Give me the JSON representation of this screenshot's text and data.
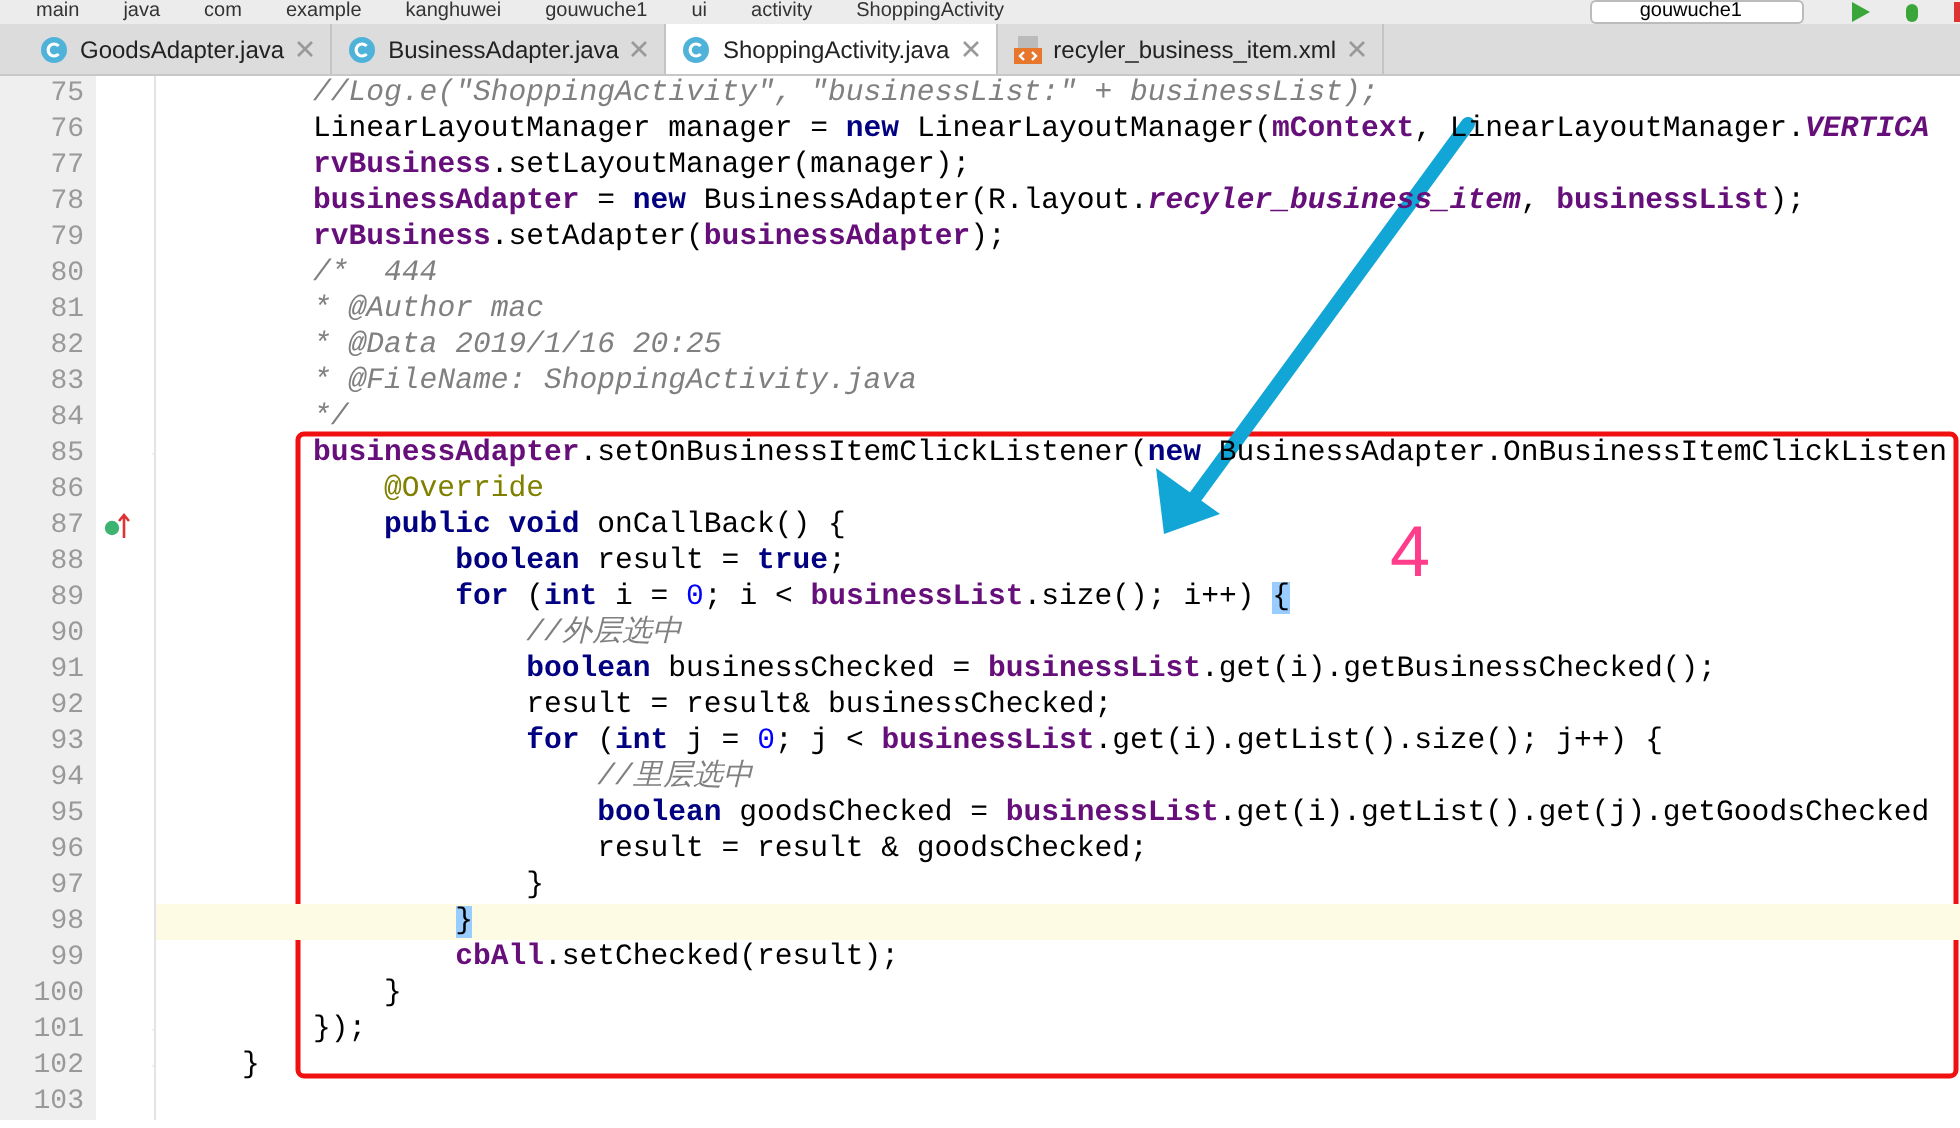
{
  "breadcrumbs": [
    "main",
    "java",
    "com",
    "example",
    "kanghuwei",
    "gouwuche1",
    "ui",
    "activity",
    "ShoppingActivity"
  ],
  "run_config": "gouwuche1",
  "tabs": [
    {
      "label": "GoodsAdapter.java",
      "kind": "java",
      "selected": false
    },
    {
      "label": "BusinessAdapter.java",
      "kind": "java",
      "selected": false
    },
    {
      "label": "ShoppingActivity.java",
      "kind": "java",
      "selected": true
    },
    {
      "label": "recyler_business_item.xml",
      "kind": "xml",
      "selected": false
    }
  ],
  "lines": [
    {
      "number": "75",
      "current": false,
      "tokens": [
        {
          "kind": "comment",
          "text": "    //Log.e(\"ShoppingActivity\", \"businessList:\" + businessList);"
        }
      ]
    },
    {
      "number": "76",
      "current": false,
      "tokens": [
        {
          "kind": "plain",
          "text": "    LinearLayoutManager manager = "
        },
        {
          "kind": "keyword",
          "text": "new"
        },
        {
          "kind": "plain",
          "text": " LinearLayoutManager("
        },
        {
          "kind": "field",
          "text": "mContext"
        },
        {
          "kind": "plain",
          "text": ", LinearLayoutManager."
        },
        {
          "kind": "static",
          "text": "VERTICA"
        }
      ]
    },
    {
      "number": "77",
      "current": false,
      "tokens": [
        {
          "kind": "field",
          "text": "    rvBusiness"
        },
        {
          "kind": "plain",
          "text": ".setLayoutManager(manager);"
        }
      ]
    },
    {
      "number": "78",
      "current": false,
      "tokens": [
        {
          "kind": "field",
          "text": "    businessAdapter"
        },
        {
          "kind": "plain",
          "text": " = "
        },
        {
          "kind": "keyword",
          "text": "new"
        },
        {
          "kind": "plain",
          "text": " BusinessAdapter(R.layout."
        },
        {
          "kind": "static",
          "text": "recyler_business_item"
        },
        {
          "kind": "plain",
          "text": ", "
        },
        {
          "kind": "field",
          "text": "businessList"
        },
        {
          "kind": "plain",
          "text": ");"
        }
      ]
    },
    {
      "number": "79",
      "current": false,
      "tokens": [
        {
          "kind": "field",
          "text": "    rvBusiness"
        },
        {
          "kind": "plain",
          "text": ".setAdapter("
        },
        {
          "kind": "field",
          "text": "businessAdapter"
        },
        {
          "kind": "plain",
          "text": ");"
        }
      ]
    },
    {
      "number": "80",
      "current": false,
      "tokens": [
        {
          "kind": "comment",
          "text": "    /*  444"
        }
      ]
    },
    {
      "number": "81",
      "current": false,
      "tokens": [
        {
          "kind": "comment",
          "text": "    * @Author mac"
        }
      ]
    },
    {
      "number": "82",
      "current": false,
      "tokens": [
        {
          "kind": "comment",
          "text": "    * @Data 2019/1/16 20:25"
        }
      ]
    },
    {
      "number": "83",
      "current": false,
      "tokens": [
        {
          "kind": "comment",
          "text": "    * @FileName: ShoppingActivity.java"
        }
      ]
    },
    {
      "number": "84",
      "current": false,
      "tokens": [
        {
          "kind": "comment",
          "text": "    */"
        }
      ]
    },
    {
      "number": "85",
      "current": false,
      "kind": "fold",
      "tokens": [
        {
          "kind": "field",
          "text": "    businessAdapter"
        },
        {
          "kind": "plain",
          "text": ".setOnBusinessItemClickListener("
        },
        {
          "kind": "keyword",
          "text": "new"
        },
        {
          "kind": "plain",
          "text": " BusinessAdapter.OnBusinessItemClickListen"
        }
      ]
    },
    {
      "number": "86",
      "current": false,
      "tokens": [
        {
          "kind": "annotation",
          "text": "        @Override"
        }
      ]
    },
    {
      "number": "87",
      "current": false,
      "kind": "override",
      "tokens": [
        {
          "kind": "keyword",
          "text": "        public void"
        },
        {
          "kind": "plain",
          "text": " onCallBack() {"
        }
      ]
    },
    {
      "number": "88",
      "current": false,
      "tokens": [
        {
          "kind": "keyword",
          "text": "            boolean"
        },
        {
          "kind": "plain",
          "text": " result = "
        },
        {
          "kind": "keyword",
          "text": "true"
        },
        {
          "kind": "plain",
          "text": ";"
        }
      ]
    },
    {
      "number": "89",
      "current": false,
      "tokens": [
        {
          "kind": "keyword",
          "text": "            for"
        },
        {
          "kind": "plain",
          "text": " ("
        },
        {
          "kind": "keyword",
          "text": "int"
        },
        {
          "kind": "plain",
          "text": " i = "
        },
        {
          "kind": "number",
          "text": "0"
        },
        {
          "kind": "plain",
          "text": "; i < "
        },
        {
          "kind": "field",
          "text": "businessList"
        },
        {
          "kind": "plain",
          "text": ".size(); i++) "
        },
        {
          "kind": "brace_match",
          "text": "{"
        }
      ]
    },
    {
      "number": "90",
      "current": false,
      "tokens": [
        {
          "kind": "comment",
          "text": "                //外层选中"
        }
      ]
    },
    {
      "number": "91",
      "current": false,
      "tokens": [
        {
          "kind": "keyword",
          "text": "                boolean"
        },
        {
          "kind": "plain",
          "text": " businessChecked = "
        },
        {
          "kind": "field",
          "text": "businessList"
        },
        {
          "kind": "plain",
          "text": ".get(i).getBusinessChecked();"
        }
      ]
    },
    {
      "number": "92",
      "current": false,
      "tokens": [
        {
          "kind": "plain",
          "text": "                result = result& businessChecked;"
        }
      ]
    },
    {
      "number": "93",
      "current": false,
      "tokens": [
        {
          "kind": "keyword",
          "text": "                for"
        },
        {
          "kind": "plain",
          "text": " ("
        },
        {
          "kind": "keyword",
          "text": "int"
        },
        {
          "kind": "plain",
          "text": " j = "
        },
        {
          "kind": "number",
          "text": "0"
        },
        {
          "kind": "plain",
          "text": "; j < "
        },
        {
          "kind": "field",
          "text": "businessList"
        },
        {
          "kind": "plain",
          "text": ".get(i).getList().size(); j++) {"
        }
      ]
    },
    {
      "number": "94",
      "current": false,
      "tokens": [
        {
          "kind": "comment",
          "text": "                    //里层选中"
        }
      ]
    },
    {
      "number": "95",
      "current": false,
      "tokens": [
        {
          "kind": "keyword",
          "text": "                    boolean"
        },
        {
          "kind": "plain",
          "text": " goodsChecked = "
        },
        {
          "kind": "field",
          "text": "businessList"
        },
        {
          "kind": "plain",
          "text": ".get(i).getList().get(j).getGoodsChecked"
        }
      ]
    },
    {
      "number": "96",
      "current": false,
      "tokens": [
        {
          "kind": "plain",
          "text": "                    result = result & goodsChecked;"
        }
      ]
    },
    {
      "number": "97",
      "current": false,
      "tokens": [
        {
          "kind": "plain",
          "text": "                }"
        }
      ]
    },
    {
      "number": "98",
      "current": true,
      "tokens": [
        {
          "kind": "brace_match",
          "text": "            }"
        }
      ]
    },
    {
      "number": "99",
      "current": false,
      "tokens": [
        {
          "kind": "field",
          "text": "            cbAll"
        },
        {
          "kind": "plain",
          "text": ".setChecked(result);"
        }
      ]
    },
    {
      "number": "100",
      "current": false,
      "tokens": [
        {
          "kind": "plain",
          "text": "        }"
        }
      ]
    },
    {
      "number": "101",
      "current": false,
      "kind": "fold",
      "tokens": [
        {
          "kind": "plain",
          "text": "    });"
        }
      ]
    },
    {
      "number": "102",
      "current": false,
      "kind": "fold",
      "tokens": [
        {
          "kind": "plain",
          "text": "}"
        }
      ]
    },
    {
      "number": "103",
      "current": false
    }
  ],
  "annotation": {
    "label": "4"
  }
}
